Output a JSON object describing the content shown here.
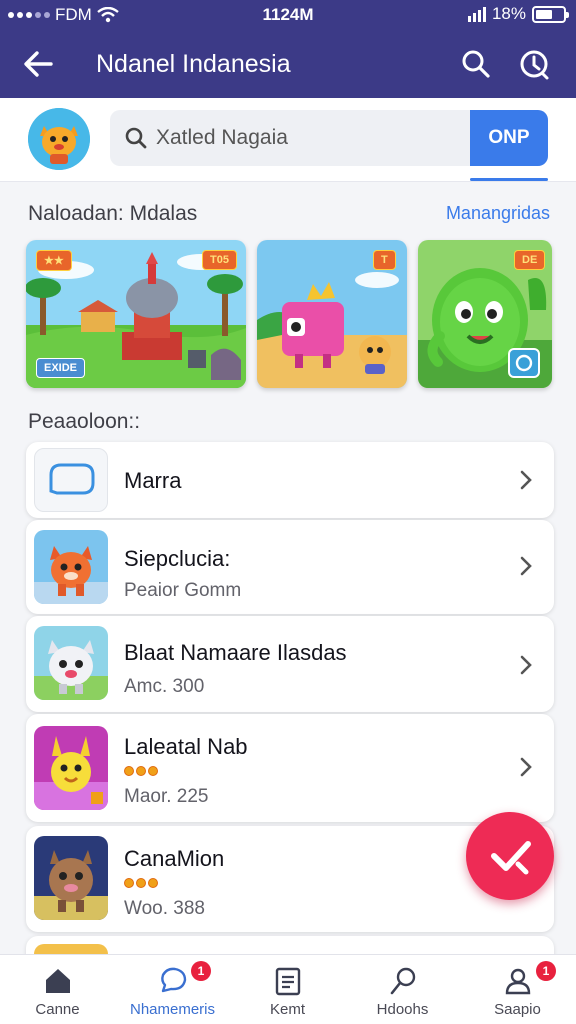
{
  "status_bar": {
    "carrier": "FDM",
    "time": "1124M",
    "battery_text": "18%",
    "battery_level": 0.6
  },
  "app_bar": {
    "title": "Ndanel Indanesia",
    "back_icon": "arrow-left-icon",
    "search_icon": "search-icon",
    "info_icon": "timer-icon"
  },
  "search": {
    "placeholder": "Xatled Nagaia",
    "button_label": "ONP"
  },
  "featured": {
    "heading": "Naloadan: Mdalas",
    "link": "Manangridas",
    "cards": [
      {
        "tag": "T05",
        "corner_label": "EXIDE"
      },
      {
        "tag": "T"
      },
      {
        "tag": "DE"
      }
    ]
  },
  "list": {
    "heading": "Peaaoloon::",
    "items": [
      {
        "name": "Marra",
        "sub": ""
      },
      {
        "name": "Siepclucia:",
        "sub": "Peaior Gomm"
      },
      {
        "name": "Blaat Namaare Ilasdas",
        "sub": "Amc. 300"
      },
      {
        "name": "Laleatal Nab",
        "sub": "Maor. 225"
      },
      {
        "name": "CanaMion",
        "sub": "Woo. 388"
      }
    ]
  },
  "fab": {
    "icon": "check-icon"
  },
  "bottom_nav": [
    {
      "label": "Canne",
      "icon": "home-icon",
      "badge": ""
    },
    {
      "label": "Nhamemeris",
      "icon": "chat-icon",
      "badge": "1"
    },
    {
      "label": "Kemt",
      "icon": "document-icon",
      "badge": ""
    },
    {
      "label": "Hdoohs",
      "icon": "discover-icon",
      "badge": ""
    },
    {
      "label": "Saapio",
      "icon": "profile-icon",
      "badge": "1"
    }
  ],
  "colors": {
    "primary": "#3c3a87",
    "accent": "#3a7bea",
    "fab": "#ee2b55",
    "badge": "#e8213e"
  }
}
